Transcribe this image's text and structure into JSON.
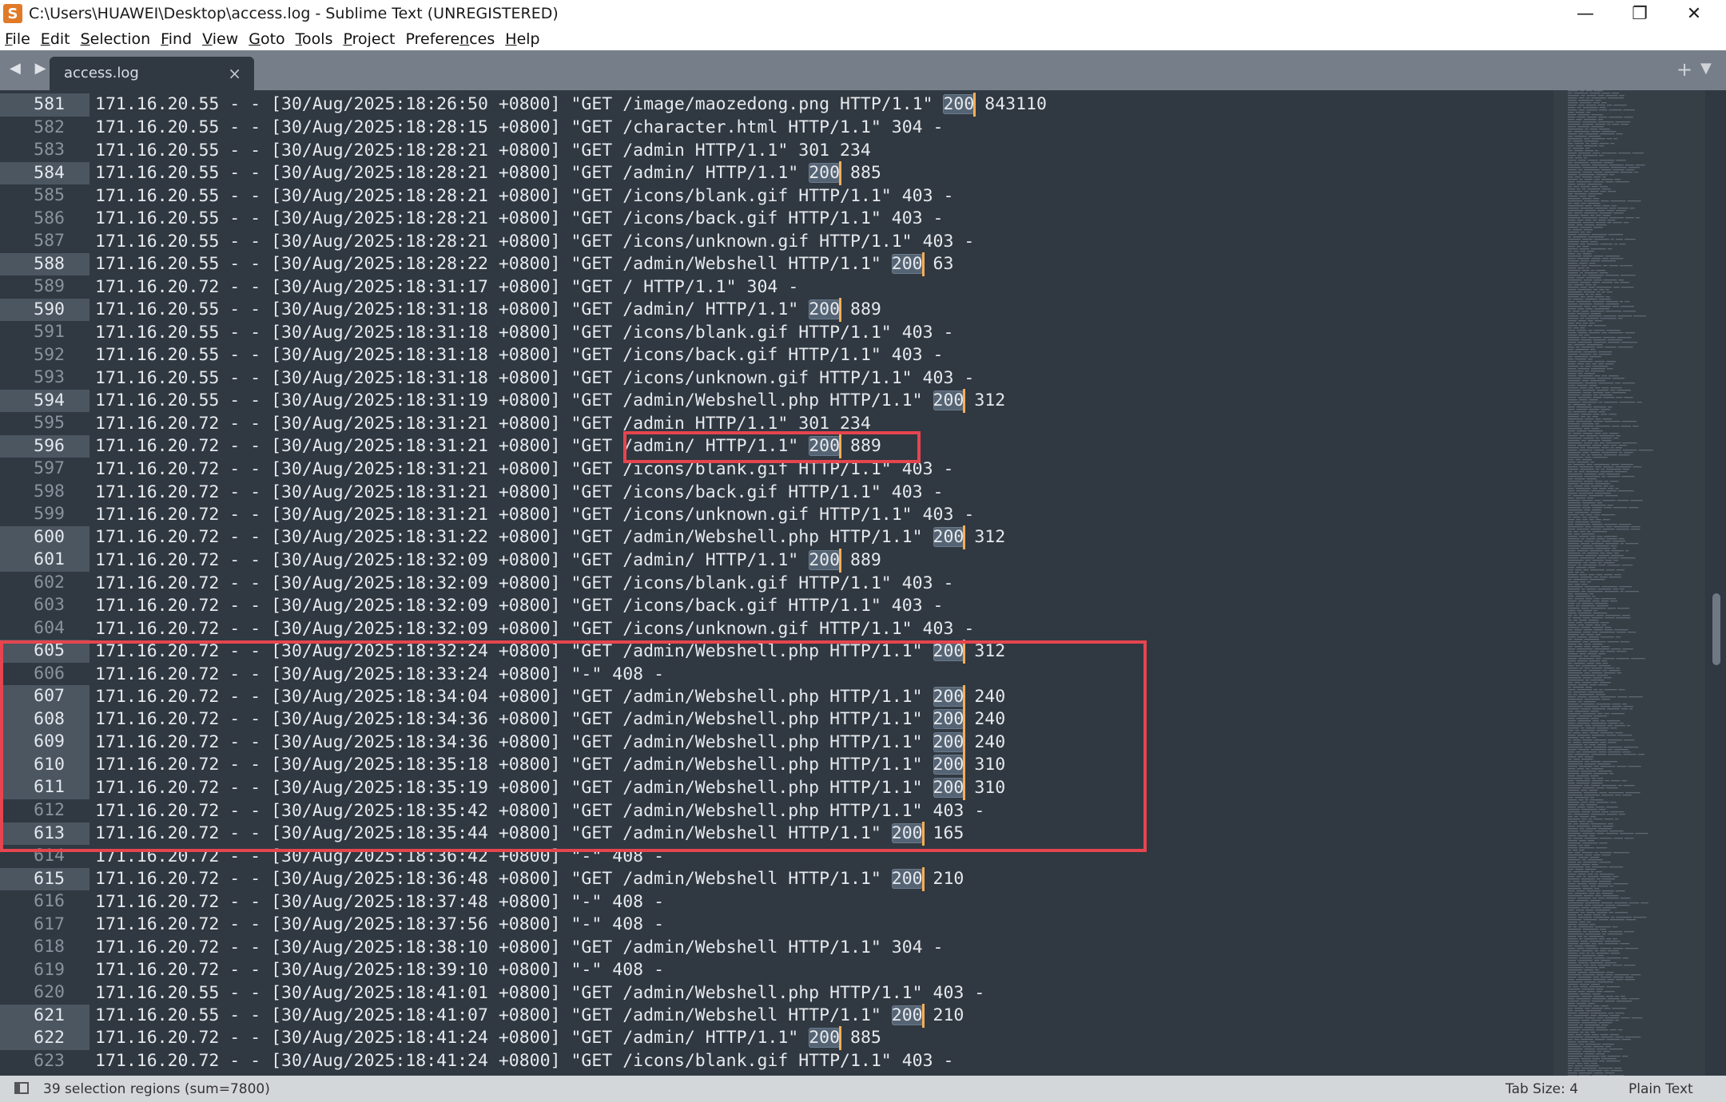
{
  "window": {
    "title": "C:\\Users\\HUAWEI\\Desktop\\access.log - Sublime Text (UNREGISTERED)",
    "app_icon": "S",
    "controls": {
      "minimize": "—",
      "maximize": "❐",
      "close": "✕"
    }
  },
  "menu": [
    {
      "key": "F",
      "rest": "ile"
    },
    {
      "key": "E",
      "rest": "dit"
    },
    {
      "key": "S",
      "rest": "election"
    },
    {
      "key": "F",
      "rest": "ind"
    },
    {
      "key": "V",
      "rest": "iew"
    },
    {
      "key": "G",
      "rest": "oto"
    },
    {
      "key": "T",
      "rest": "ools"
    },
    {
      "key": "P",
      "rest": "roject"
    },
    {
      "pre": "Prefere",
      "key": "n",
      "rest": "ces"
    },
    {
      "key": "H",
      "rest": "elp"
    }
  ],
  "tabs": {
    "nav": "◀ ▶",
    "active_tab": {
      "label": "access.log",
      "close": "×"
    },
    "add": "+",
    "menu": "▼"
  },
  "lines": [
    {
      "n": "581",
      "ip": "171.16.20.55",
      "time": "[30/Aug/2025:18:26:50 +0800]",
      "req": "\"GET /image/maozedong.png HTTP/1.1\"",
      "status": "200",
      "size": "843110",
      "sel": true
    },
    {
      "n": "582",
      "ip": "171.16.20.55",
      "time": "[30/Aug/2025:18:28:15 +0800]",
      "req": "\"GET /character.html HTTP/1.1\"",
      "status": "304",
      "size": "-",
      "sel": false
    },
    {
      "n": "583",
      "ip": "171.16.20.55",
      "time": "[30/Aug/2025:18:28:21 +0800]",
      "req": "\"GET /admin HTTP/1.1\"",
      "status": "301",
      "size": "234",
      "sel": false
    },
    {
      "n": "584",
      "ip": "171.16.20.55",
      "time": "[30/Aug/2025:18:28:21 +0800]",
      "req": "\"GET /admin/ HTTP/1.1\"",
      "status": "200",
      "size": "885",
      "sel": true
    },
    {
      "n": "585",
      "ip": "171.16.20.55",
      "time": "[30/Aug/2025:18:28:21 +0800]",
      "req": "\"GET /icons/blank.gif HTTP/1.1\"",
      "status": "403",
      "size": "-",
      "sel": false
    },
    {
      "n": "586",
      "ip": "171.16.20.55",
      "time": "[30/Aug/2025:18:28:21 +0800]",
      "req": "\"GET /icons/back.gif HTTP/1.1\"",
      "status": "403",
      "size": "-",
      "sel": false
    },
    {
      "n": "587",
      "ip": "171.16.20.55",
      "time": "[30/Aug/2025:18:28:21 +0800]",
      "req": "\"GET /icons/unknown.gif HTTP/1.1\"",
      "status": "403",
      "size": "-",
      "sel": false
    },
    {
      "n": "588",
      "ip": "171.16.20.55",
      "time": "[30/Aug/2025:18:28:22 +0800]",
      "req": "\"GET /admin/Webshell HTTP/1.1\"",
      "status": "200",
      "size": "63",
      "sel": true
    },
    {
      "n": "589",
      "ip": "171.16.20.72",
      "time": "[30/Aug/2025:18:31:17 +0800]",
      "req": "\"GET / HTTP/1.1\"",
      "status": "304",
      "size": "-",
      "sel": false
    },
    {
      "n": "590",
      "ip": "171.16.20.55",
      "time": "[30/Aug/2025:18:31:18 +0800]",
      "req": "\"GET /admin/ HTTP/1.1\"",
      "status": "200",
      "size": "889",
      "sel": true
    },
    {
      "n": "591",
      "ip": "171.16.20.55",
      "time": "[30/Aug/2025:18:31:18 +0800]",
      "req": "\"GET /icons/blank.gif HTTP/1.1\"",
      "status": "403",
      "size": "-",
      "sel": false
    },
    {
      "n": "592",
      "ip": "171.16.20.55",
      "time": "[30/Aug/2025:18:31:18 +0800]",
      "req": "\"GET /icons/back.gif HTTP/1.1\"",
      "status": "403",
      "size": "-",
      "sel": false
    },
    {
      "n": "593",
      "ip": "171.16.20.55",
      "time": "[30/Aug/2025:18:31:18 +0800]",
      "req": "\"GET /icons/unknown.gif HTTP/1.1\"",
      "status": "403",
      "size": "-",
      "sel": false
    },
    {
      "n": "594",
      "ip": "171.16.20.55",
      "time": "[30/Aug/2025:18:31:19 +0800]",
      "req": "\"GET /admin/Webshell.php HTTP/1.1\"",
      "status": "200",
      "size": "312",
      "sel": true
    },
    {
      "n": "595",
      "ip": "171.16.20.72",
      "time": "[30/Aug/2025:18:31:21 +0800]",
      "req": "\"GET /admin HTTP/1.1\"",
      "status": "301",
      "size": "234",
      "sel": false
    },
    {
      "n": "596",
      "ip": "171.16.20.72",
      "time": "[30/Aug/2025:18:31:21 +0800]",
      "req": "\"GET /admin/ HTTP/1.1\"",
      "status": "200",
      "size": "889",
      "sel": true
    },
    {
      "n": "597",
      "ip": "171.16.20.72",
      "time": "[30/Aug/2025:18:31:21 +0800]",
      "req": "\"GET /icons/blank.gif HTTP/1.1\"",
      "status": "403",
      "size": "-",
      "sel": false
    },
    {
      "n": "598",
      "ip": "171.16.20.72",
      "time": "[30/Aug/2025:18:31:21 +0800]",
      "req": "\"GET /icons/back.gif HTTP/1.1\"",
      "status": "403",
      "size": "-",
      "sel": false
    },
    {
      "n": "599",
      "ip": "171.16.20.72",
      "time": "[30/Aug/2025:18:31:21 +0800]",
      "req": "\"GET /icons/unknown.gif HTTP/1.1\"",
      "status": "403",
      "size": "-",
      "sel": false
    },
    {
      "n": "600",
      "ip": "171.16.20.72",
      "time": "[30/Aug/2025:18:31:22 +0800]",
      "req": "\"GET /admin/Webshell.php HTTP/1.1\"",
      "status": "200",
      "size": "312",
      "sel": true
    },
    {
      "n": "601",
      "ip": "171.16.20.72",
      "time": "[30/Aug/2025:18:32:09 +0800]",
      "req": "\"GET /admin/ HTTP/1.1\"",
      "status": "200",
      "size": "889",
      "sel": true
    },
    {
      "n": "602",
      "ip": "171.16.20.72",
      "time": "[30/Aug/2025:18:32:09 +0800]",
      "req": "\"GET /icons/blank.gif HTTP/1.1\"",
      "status": "403",
      "size": "-",
      "sel": false
    },
    {
      "n": "603",
      "ip": "171.16.20.72",
      "time": "[30/Aug/2025:18:32:09 +0800]",
      "req": "\"GET /icons/back.gif HTTP/1.1\"",
      "status": "403",
      "size": "-",
      "sel": false
    },
    {
      "n": "604",
      "ip": "171.16.20.72",
      "time": "[30/Aug/2025:18:32:09 +0800]",
      "req": "\"GET /icons/unknown.gif HTTP/1.1\"",
      "status": "403",
      "size": "-",
      "sel": false
    },
    {
      "n": "605",
      "ip": "171.16.20.72",
      "time": "[30/Aug/2025:18:32:24 +0800]",
      "req": "\"GET /admin/Webshell.php HTTP/1.1\"",
      "status": "200",
      "size": "312",
      "sel": true
    },
    {
      "n": "606",
      "ip": "171.16.20.72",
      "time": "[30/Aug/2025:18:33:24 +0800]",
      "req": "\"-\"",
      "status": "408",
      "size": "-",
      "sel": false
    },
    {
      "n": "607",
      "ip": "171.16.20.72",
      "time": "[30/Aug/2025:18:34:04 +0800]",
      "req": "\"GET /admin/Webshell.php HTTP/1.1\"",
      "status": "200",
      "size": "240",
      "sel": true
    },
    {
      "n": "608",
      "ip": "171.16.20.72",
      "time": "[30/Aug/2025:18:34:36 +0800]",
      "req": "\"GET /admin/Webshell.php HTTP/1.1\"",
      "status": "200",
      "size": "240",
      "sel": true
    },
    {
      "n": "609",
      "ip": "171.16.20.72",
      "time": "[30/Aug/2025:18:34:36 +0800]",
      "req": "\"GET /admin/Webshell.php HTTP/1.1\"",
      "status": "200",
      "size": "240",
      "sel": true
    },
    {
      "n": "610",
      "ip": "171.16.20.72",
      "time": "[30/Aug/2025:18:35:18 +0800]",
      "req": "\"GET /admin/Webshell.php HTTP/1.1\"",
      "status": "200",
      "size": "310",
      "sel": true
    },
    {
      "n": "611",
      "ip": "171.16.20.72",
      "time": "[30/Aug/2025:18:35:19 +0800]",
      "req": "\"GET /admin/Webshell.php HTTP/1.1\"",
      "status": "200",
      "size": "310",
      "sel": true
    },
    {
      "n": "612",
      "ip": "171.16.20.72",
      "time": "[30/Aug/2025:18:35:42 +0800]",
      "req": "\"GET /admin/Webshell.php HTTP/1.1\"",
      "status": "403",
      "size": "-",
      "sel": false
    },
    {
      "n": "613",
      "ip": "171.16.20.72",
      "time": "[30/Aug/2025:18:35:44 +0800]",
      "req": "\"GET /admin/Webshell HTTP/1.1\"",
      "status": "200",
      "size": "165",
      "sel": true
    },
    {
      "n": "614",
      "ip": "171.16.20.72",
      "time": "[30/Aug/2025:18:36:42 +0800]",
      "req": "\"-\"",
      "status": "408",
      "size": "-",
      "sel": false
    },
    {
      "n": "615",
      "ip": "171.16.20.72",
      "time": "[30/Aug/2025:18:36:48 +0800]",
      "req": "\"GET /admin/Webshell HTTP/1.1\"",
      "status": "200",
      "size": "210",
      "sel": true
    },
    {
      "n": "616",
      "ip": "171.16.20.72",
      "time": "[30/Aug/2025:18:37:48 +0800]",
      "req": "\"-\"",
      "status": "408",
      "size": "-",
      "sel": false
    },
    {
      "n": "617",
      "ip": "171.16.20.72",
      "time": "[30/Aug/2025:18:37:56 +0800]",
      "req": "\"-\"",
      "status": "408",
      "size": "-",
      "sel": false
    },
    {
      "n": "618",
      "ip": "171.16.20.72",
      "time": "[30/Aug/2025:18:38:10 +0800]",
      "req": "\"GET /admin/Webshell HTTP/1.1\"",
      "status": "304",
      "size": "-",
      "sel": false
    },
    {
      "n": "619",
      "ip": "171.16.20.72",
      "time": "[30/Aug/2025:18:39:10 +0800]",
      "req": "\"-\"",
      "status": "408",
      "size": "-",
      "sel": false
    },
    {
      "n": "620",
      "ip": "171.16.20.55",
      "time": "[30/Aug/2025:18:41:01 +0800]",
      "req": "\"GET /admin/Webshell.php HTTP/1.1\"",
      "status": "403",
      "size": "-",
      "sel": false
    },
    {
      "n": "621",
      "ip": "171.16.20.55",
      "time": "[30/Aug/2025:18:41:07 +0800]",
      "req": "\"GET /admin/Webshell HTTP/1.1\"",
      "status": "200",
      "size": "210",
      "sel": true
    },
    {
      "n": "622",
      "ip": "171.16.20.72",
      "time": "[30/Aug/2025:18:41:24 +0800]",
      "req": "\"GET /admin/ HTTP/1.1\"",
      "status": "200",
      "size": "885",
      "sel": true
    },
    {
      "n": "623",
      "ip": "171.16.20.72",
      "time": "[30/Aug/2025:18:41:24 +0800]",
      "req": "\"GET /icons/blank.gif HTTP/1.1\"",
      "status": "403",
      "size": "-",
      "sel": false
    }
  ],
  "status_bar": {
    "selection": "39 selection regions (sum=7800)",
    "tab_size": "Tab Size: 4",
    "syntax": "Plain Text"
  },
  "colors": {
    "editor_bg": "#303841",
    "selection": "#556474",
    "caret": "#f9ae58",
    "annotation": "#e5454f",
    "tabbar": "#767f89"
  }
}
